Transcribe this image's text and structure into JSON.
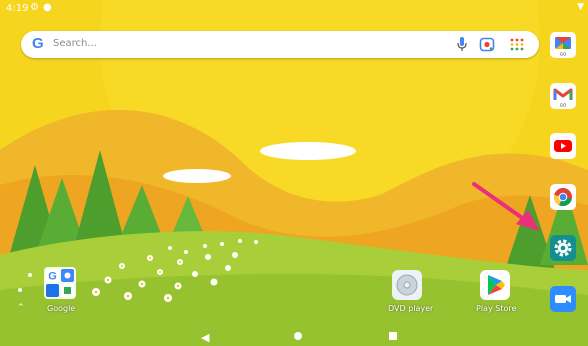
{
  "status_bar": {
    "time": "4:19"
  },
  "search": {
    "placeholder": "Search..."
  },
  "dock": [
    {
      "name": "google-go-app",
      "badge": "GO"
    },
    {
      "name": "gmail-go-app",
      "badge": "GO"
    },
    {
      "name": "youtube-app"
    },
    {
      "name": "chrome-app"
    },
    {
      "name": "settings-app"
    },
    {
      "name": "zoom-app"
    }
  ],
  "home": {
    "folder_label": "Google",
    "dvd_label": "DVD player",
    "play_label": "Play Store"
  },
  "colors": {
    "accent_arrow": "#e8317a",
    "settings_teal": "#138f8f"
  }
}
